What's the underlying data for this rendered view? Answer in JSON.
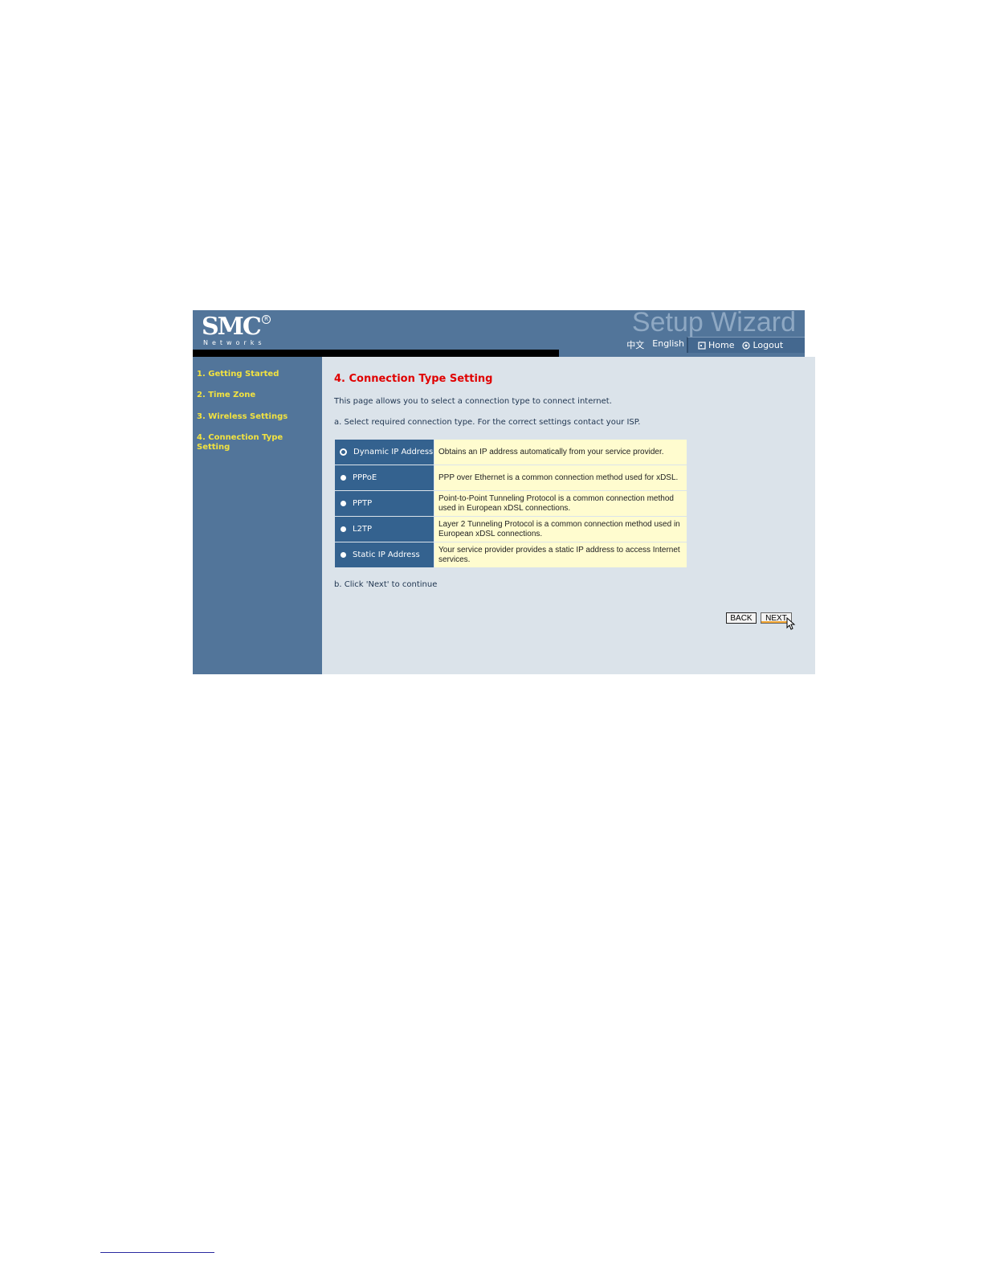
{
  "header": {
    "logo": "SMC",
    "logo_reg": "R",
    "logo_sub": "Networks",
    "wizard_title": "Setup Wizard",
    "lang_chinese": "中文",
    "lang_english": "English",
    "home": "Home",
    "logout": "Logout"
  },
  "sidebar": {
    "items": [
      {
        "label": "1. Getting Started"
      },
      {
        "label": "2. Time Zone"
      },
      {
        "label": "3. Wireless Settings"
      },
      {
        "label": "4. Connection Type Setting"
      }
    ]
  },
  "main": {
    "title": "4. Connection Type Setting",
    "intro": "This page allows you to select a connection type to connect internet.",
    "step_a": "a. Select required connection type. For the correct settings contact your ISP.",
    "step_b": "b. Click 'Next' to continue",
    "options": [
      {
        "label": "Dynamic IP Address",
        "desc": "Obtains an IP address automatically from your service provider.",
        "checked": true
      },
      {
        "label": "PPPoE",
        "desc": "PPP over Ethernet is a common connection method used for xDSL.",
        "checked": false
      },
      {
        "label": "PPTP",
        "desc": "Point-to-Point Tunneling Protocol is a common connection method used in European xDSL connections.",
        "checked": false
      },
      {
        "label": "L2TP",
        "desc": "Layer 2 Tunneling Protocol is a common connection method used in European xDSL connections.",
        "checked": false
      },
      {
        "label": "Static IP Address",
        "desc": "Your service provider provides a static IP address to access Internet services.",
        "checked": false
      }
    ],
    "back_label": "BACK",
    "next_label": "NEXT"
  },
  "icons": {
    "home": "home-icon",
    "logout": "logout-icon",
    "cursor": "mouse-pointer-icon"
  }
}
